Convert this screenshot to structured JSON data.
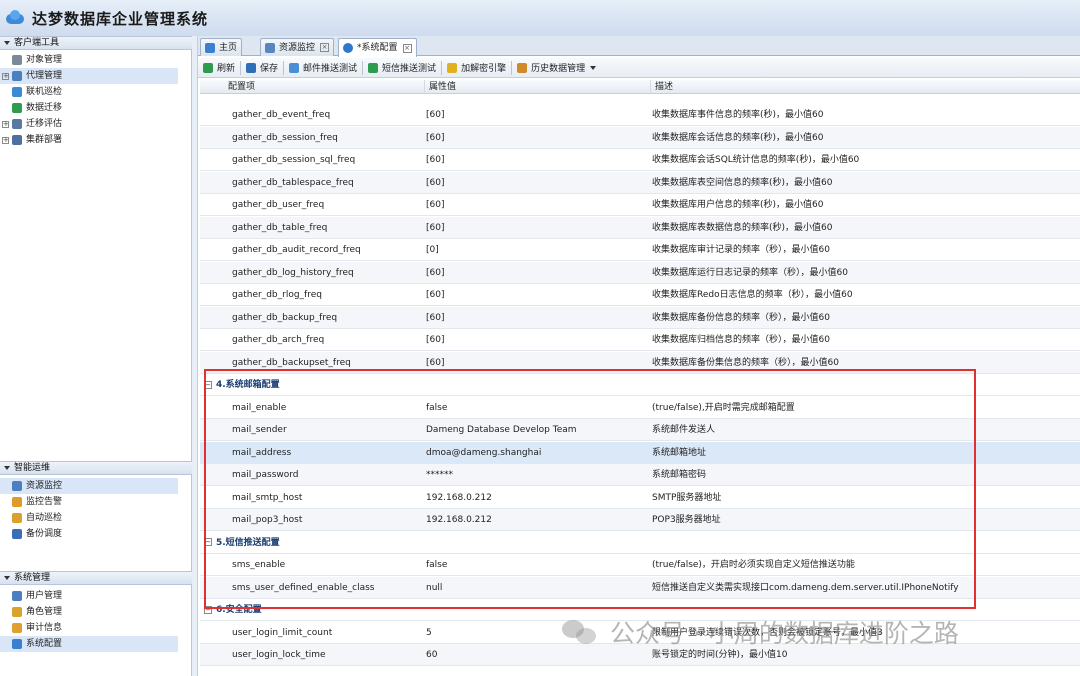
{
  "app": {
    "title": "达梦数据库企业管理系统"
  },
  "left": {
    "client_tools": {
      "header": "客户端工具",
      "items": [
        {
          "label": "对象管理",
          "icon": "object-icon",
          "color": "#7b8a99",
          "expandable": false
        },
        {
          "label": "代理管理",
          "icon": "agent-icon",
          "color": "#4a7fc0",
          "expandable": true,
          "selected": true
        },
        {
          "label": "联机巡检",
          "icon": "inspect-icon",
          "color": "#3a8bd6",
          "expandable": false
        },
        {
          "label": "数据迁移",
          "icon": "migrate-icon",
          "color": "#2f9b4f",
          "expandable": false
        },
        {
          "label": "迁移评估",
          "icon": "assess-icon",
          "color": "#5a7aa6",
          "expandable": true
        },
        {
          "label": "集群部署",
          "icon": "cluster-icon",
          "color": "#4f6fa0",
          "expandable": true
        }
      ]
    },
    "ops": {
      "header": "智能运维",
      "items": [
        {
          "label": "资源监控",
          "icon": "monitor-icon",
          "color": "#4a7fc0",
          "selected": true
        },
        {
          "label": "监控告警",
          "icon": "alarm-icon",
          "color": "#e09a2a"
        },
        {
          "label": "自动巡检",
          "icon": "auto-inspect-icon",
          "color": "#d9a22c"
        },
        {
          "label": "备份调度",
          "icon": "backup-icon",
          "color": "#3a6fb8"
        }
      ]
    },
    "system": {
      "header": "系统管理",
      "items": [
        {
          "label": "用户管理",
          "icon": "user-icon",
          "color": "#4a7fc0"
        },
        {
          "label": "角色管理",
          "icon": "role-icon",
          "color": "#d9a22c"
        },
        {
          "label": "审计信息",
          "icon": "audit-icon",
          "color": "#e0a030"
        },
        {
          "label": "系统配置",
          "icon": "gear-icon",
          "color": "#3a7fd0",
          "selected": true
        }
      ]
    }
  },
  "tabs": [
    {
      "label": "主页",
      "icon": "home-icon",
      "closable": false
    },
    {
      "label": "资源监控",
      "icon": "monitor-icon",
      "closable": true
    },
    {
      "label": "*系统配置",
      "icon": "gear-icon",
      "closable": true,
      "active": true
    }
  ],
  "toolbar": {
    "buttons": [
      {
        "label": "刷新",
        "icon": "refresh-icon",
        "color": "#2f9b4f"
      },
      {
        "label": "保存",
        "icon": "save-icon",
        "color": "#2f6fb8"
      },
      {
        "label": "邮件推送测试",
        "icon": "mail-icon",
        "color": "#4a8fd6"
      },
      {
        "label": "短信推送测试",
        "icon": "sms-icon",
        "color": "#2f9b4f"
      },
      {
        "label": "加解密引擎",
        "icon": "key-icon",
        "color": "#e0b020"
      },
      {
        "label": "历史数据管理",
        "icon": "history-icon",
        "color": "#d08a2a",
        "dropdown": true
      }
    ]
  },
  "grid": {
    "columns": [
      "配置项",
      "属性值",
      "描述"
    ],
    "rows_top": [
      {
        "name": "gather_db_event_freq",
        "value": "[60]",
        "desc": "收集数据库事件信息的频率(秒)，最小值60"
      },
      {
        "name": "gather_db_session_freq",
        "value": "[60]",
        "desc": "收集数据库会话信息的频率(秒)，最小值60"
      },
      {
        "name": "gather_db_session_sql_freq",
        "value": "[60]",
        "desc": "收集数据库会话SQL统计信息的频率(秒)，最小值60"
      },
      {
        "name": "gather_db_tablespace_freq",
        "value": "[60]",
        "desc": "收集数据库表空间信息的频率(秒)，最小值60"
      },
      {
        "name": "gather_db_user_freq",
        "value": "[60]",
        "desc": "收集数据库用户信息的频率(秒)，最小值60"
      },
      {
        "name": "gather_db_table_freq",
        "value": "[60]",
        "desc": "收集数据库表数据信息的频率(秒)，最小值60"
      },
      {
        "name": "gather_db_audit_record_freq",
        "value": "[0]",
        "desc": "收集数据库审计记录的频率（秒），最小值60"
      },
      {
        "name": "gather_db_log_history_freq",
        "value": "[60]",
        "desc": "收集数据库运行日志记录的频率（秒），最小值60"
      },
      {
        "name": "gather_db_rlog_freq",
        "value": "[60]",
        "desc": "收集数据库Redo日志信息的频率（秒），最小值60"
      },
      {
        "name": "gather_db_backup_freq",
        "value": "[60]",
        "desc": "收集数据库备份信息的频率（秒），最小值60"
      },
      {
        "name": "gather_db_arch_freq",
        "value": "[60]",
        "desc": "收集数据库归档信息的频率（秒），最小值60"
      },
      {
        "name": "gather_db_backupset_freq",
        "value": "[60]",
        "desc": "收集数据库备份集信息的频率（秒），最小值60"
      }
    ],
    "group_mail": "4.系统邮箱配置",
    "rows_mail": [
      {
        "name": "mail_enable",
        "value": "false",
        "desc": "(true/false),开启时需完成邮箱配置"
      },
      {
        "name": "mail_sender",
        "value": "Dameng Database Develop Team",
        "desc": "系统邮件发送人"
      },
      {
        "name": "mail_address",
        "value": "dmoa@dameng.shanghai",
        "desc": "系统邮箱地址",
        "selected": true
      },
      {
        "name": "mail_password",
        "value": "******",
        "desc": "系统邮箱密码"
      },
      {
        "name": "mail_smtp_host",
        "value": "192.168.0.212",
        "desc": "SMTP服务器地址"
      },
      {
        "name": "mail_pop3_host",
        "value": "192.168.0.212",
        "desc": "POP3服务器地址"
      }
    ],
    "group_sms": "5.短信推送配置",
    "rows_sms": [
      {
        "name": "sms_enable",
        "value": "false",
        "desc": "(true/false)，开启时必须实现自定义短信推送功能"
      },
      {
        "name": "sms_user_defined_enable_class",
        "value": "null",
        "desc": "短信推送自定义类需实现接口com.dameng.dem.server.util.IPhoneNotify"
      }
    ],
    "group_security": "6.安全配置",
    "rows_security": [
      {
        "name": "user_login_limit_count",
        "value": "5",
        "desc": "限制用户登录连续错误次数，否则会被锁定账号，最小值3"
      },
      {
        "name": "user_login_lock_time",
        "value": "60",
        "desc": "账号锁定的时间(分钟)，最小值10"
      }
    ]
  },
  "watermark": {
    "text": "公众号 · 小周的数据库进阶之路"
  },
  "colors": {
    "highlight": "#e03030",
    "selected_row": "#dbe8f7",
    "group_text": "#1d3f73"
  }
}
